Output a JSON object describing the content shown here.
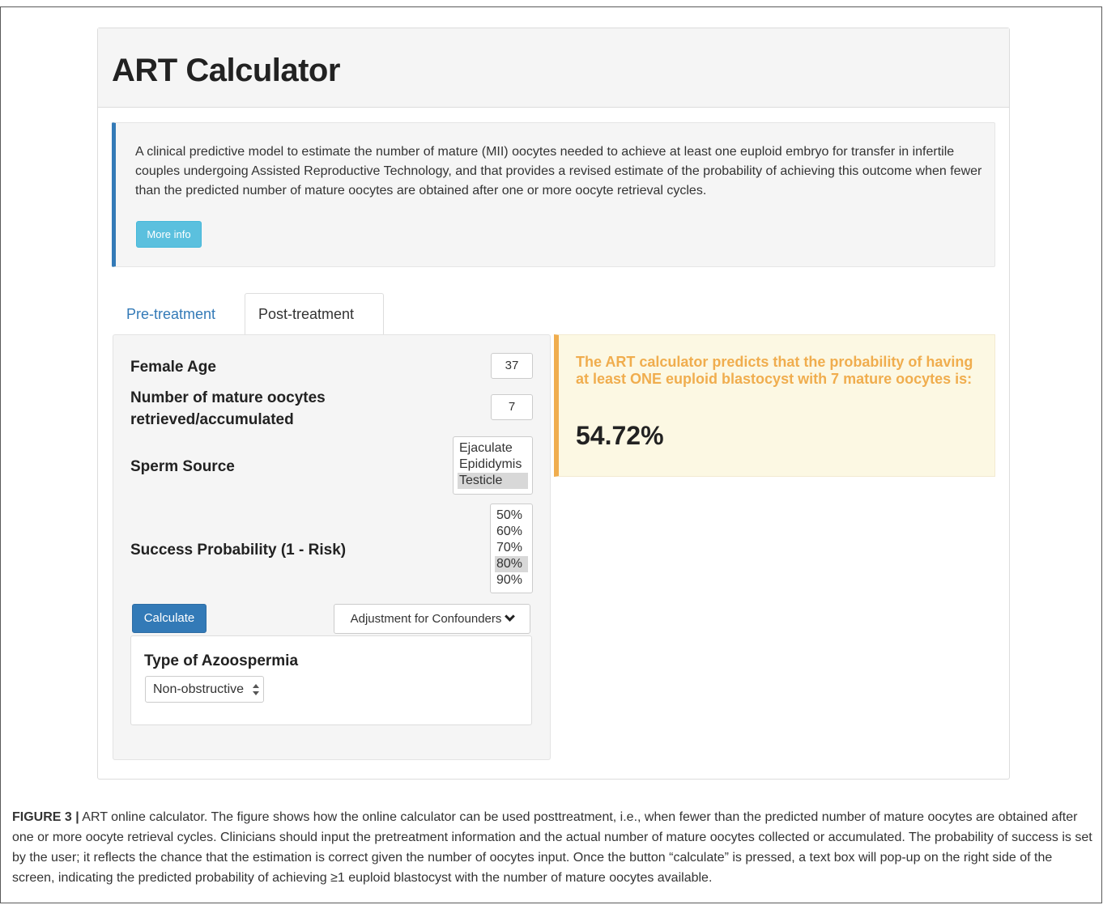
{
  "app": {
    "title": "ART Calculator",
    "description": "A clinical predictive model to estimate the number of mature (MII) oocytes needed to achieve at least one euploid embryo for transfer in infertile couples undergoing Assisted Reproductive Technology, and that provides a revised estimate of the probability of achieving this outcome when fewer than the predicted number of mature oocytes are obtained after one or more oocyte retrieval cycles.",
    "more_info_label": "More info"
  },
  "tabs": [
    {
      "label": "Pre-treatment",
      "active": false
    },
    {
      "label": "Post-treatment",
      "active": true
    }
  ],
  "form": {
    "female_age_label": "Female Age",
    "female_age_value": "37",
    "oocytes_label": "Number of mature oocytes retrieved/accumulated",
    "oocytes_value": "7",
    "sperm_source_label": "Sperm Source",
    "sperm_source_options": [
      "Ejaculate",
      "Epididymis",
      "Testicle"
    ],
    "sperm_source_selected": "Testicle",
    "success_label": "Success Probability (1 - Risk)",
    "success_options": [
      "50%",
      "60%",
      "70%",
      "80%",
      "90%"
    ],
    "success_selected": "80%",
    "calculate_label": "Calculate",
    "confounders_label": "Adjustment for Confounders",
    "azoospermia_label": "Type of Azoospermia",
    "azoospermia_value": "Non-obstructive"
  },
  "result": {
    "text": "The ART calculator predicts that the probability of having at least ONE euploid blastocyst with 7 mature oocytes is:",
    "value": "54.72%"
  },
  "caption": {
    "label": "FIGURE 3 |",
    "text": "ART online calculator. The figure shows how the online calculator can be used posttreatment, i.e., when fewer than the predicted number of mature oocytes are obtained after one or more oocyte retrieval cycles. Clinicians should input the pretreatment information and the actual number of mature oocytes collected or accumulated. The probability of success is set by the user; it reflects the chance that the estimation is correct given the number of oocytes input. Once the button “calculate” is pressed, a text box will pop-up on the right side of the screen, indicating the predicted probability of achieving ≥1 euploid blastocyst with the number of mature oocytes available."
  },
  "colors": {
    "primary": "#337ab7",
    "info": "#5bc0de",
    "warning": "#f0ad4e",
    "warning_bg": "#fcf8e3"
  }
}
